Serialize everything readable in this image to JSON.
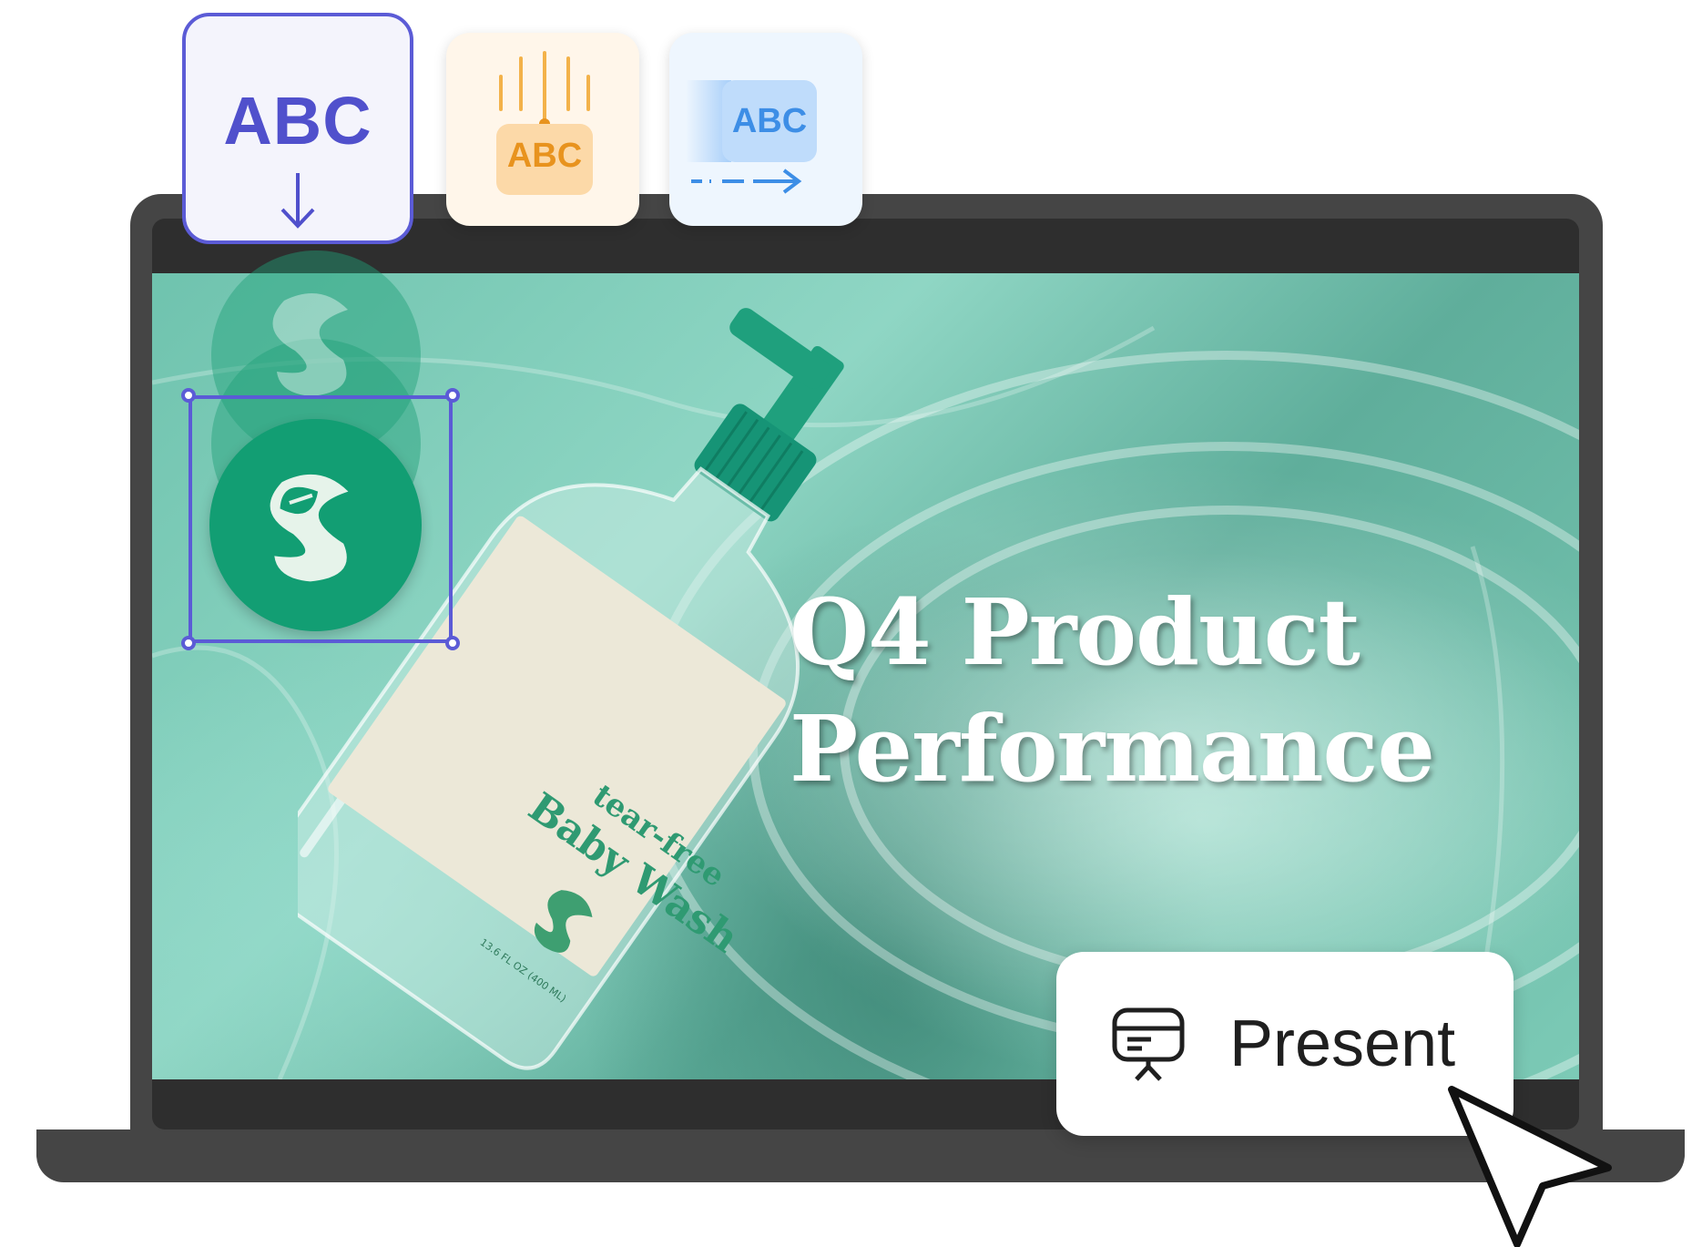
{
  "toolbar": {
    "animations": [
      {
        "name": "drop-in",
        "label": "ABC",
        "selected": true
      },
      {
        "name": "fall",
        "label": "ABC",
        "selected": false
      },
      {
        "name": "slide-in",
        "label": "ABC",
        "selected": false
      }
    ]
  },
  "slide": {
    "title_line1": "Q4 Product",
    "title_line2": "Performance",
    "product": {
      "label_line1": "tear-free",
      "label_line2": "Baby Wash",
      "volume": "13.6 FL OZ (400 ML)"
    }
  },
  "present_button": {
    "label": "Present"
  },
  "colors": {
    "accent": "#5b5bd6",
    "brand_green": "#129e73",
    "laptop": "#454545",
    "orange": "#e8931e",
    "blue": "#3d8ee6"
  },
  "icons": [
    "arrow-down-icon",
    "fall-lines-icon",
    "arrow-right-icon",
    "leaf-logo-icon",
    "presentation-icon",
    "cursor-icon"
  ]
}
